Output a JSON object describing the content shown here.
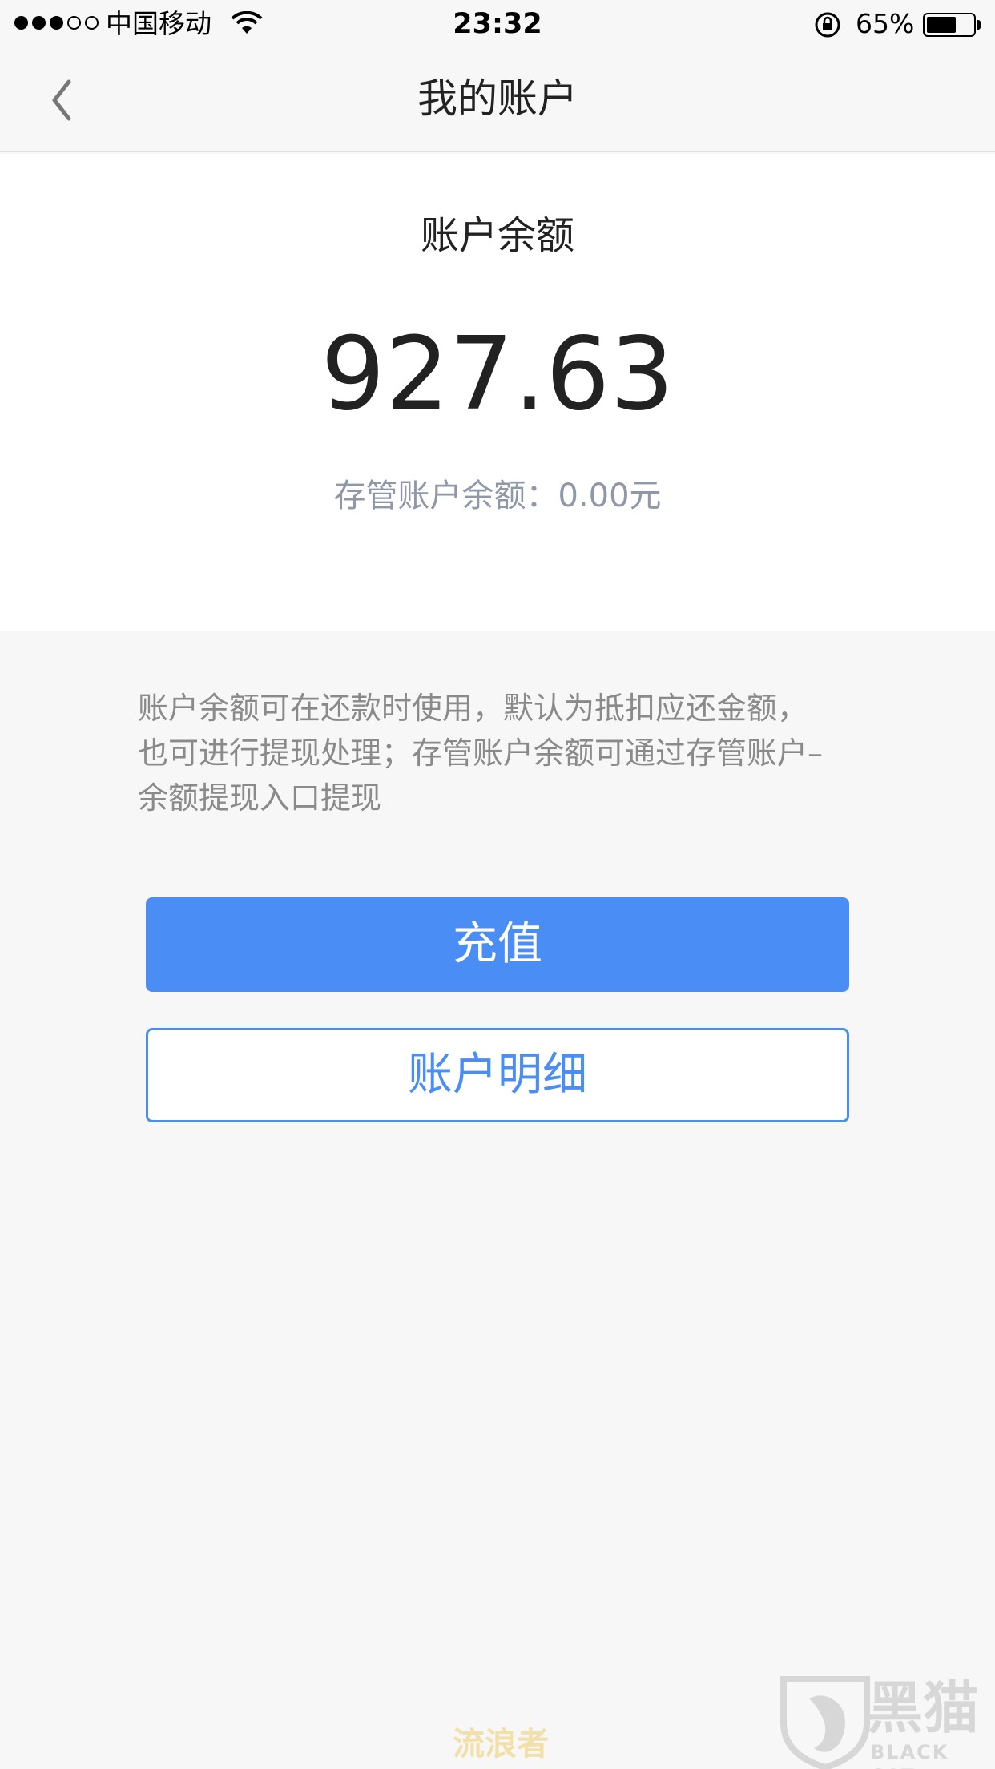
{
  "status_bar": {
    "carrier": "中国移动",
    "time": "23:32",
    "battery_percent": "65%",
    "battery_level": 0.65,
    "signal_bars": 3,
    "signal_total": 5,
    "icons": [
      "wifi-icon",
      "rotation-lock-icon",
      "battery-icon"
    ]
  },
  "nav": {
    "title": "我的账户",
    "back_icon": "chevron-left-icon"
  },
  "balance": {
    "label": "账户余额",
    "amount": "927.63",
    "custody_balance": "存管账户余额：0.00元"
  },
  "description": {
    "lines": [
      "账户余额可在还款时使用，默认为抵扣应还金额，",
      "也可进行提现处理；存管账户余额可通过存管账户–",
      "余额提现入口提现"
    ]
  },
  "actions": {
    "recharge_label": "充值",
    "details_label": "账户明细"
  },
  "watermarks": {
    "user_text": "流浪者",
    "brand_cn": "黑猫",
    "brand_en": "BLACK CAT"
  },
  "colors": {
    "accent": "#4a8ef5",
    "muted_text": "#8f97a8",
    "background": "#f7f7f7"
  }
}
